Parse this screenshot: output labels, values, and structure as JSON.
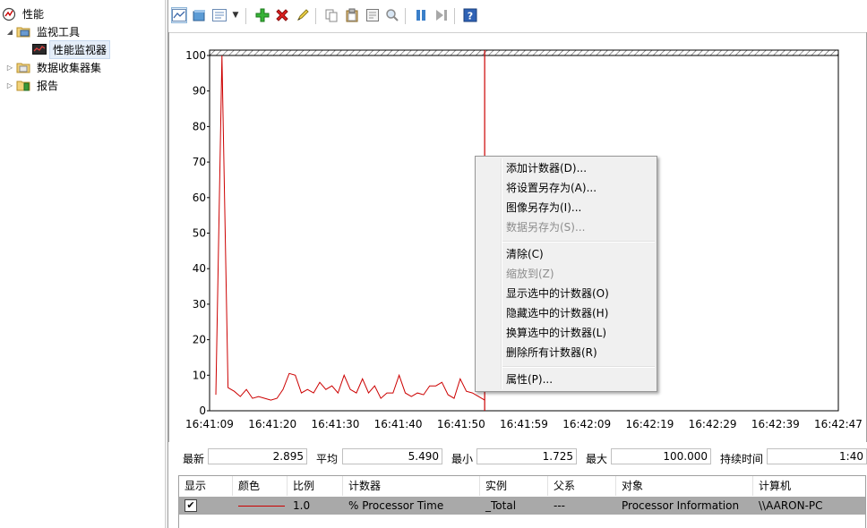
{
  "tree": {
    "root": "性能",
    "monitoring_tools": "监视工具",
    "performance_monitor": "性能监视器",
    "data_collector_sets": "数据收集器集",
    "reports": "报告"
  },
  "toolbar": {
    "icons": [
      "view-graph-icon",
      "view-histogram-icon",
      "view-report-icon",
      "dropdown-icon",
      "add-counter-icon",
      "delete-counter-icon",
      "highlight-icon",
      "copy-properties-icon",
      "paste-counters-icon",
      "properties-icon",
      "zoom-icon",
      "freeze-display-icon",
      "update-data-icon",
      "help-icon"
    ]
  },
  "chart_data": {
    "type": "line",
    "ylim": [
      0,
      100
    ],
    "yticks": [
      "100",
      "90",
      "80",
      "70",
      "60",
      "50",
      "40",
      "30",
      "20",
      "10",
      "0"
    ],
    "xticks": [
      "16:41:09",
      "16:41:20",
      "16:41:30",
      "16:41:40",
      "16:41:50",
      "16:41:59",
      "16:42:09",
      "16:42:19",
      "16:42:29",
      "16:42:39",
      "16:42:47"
    ],
    "series": [
      {
        "color": "#cc0000",
        "values": [
          4.5,
          100,
          6.5,
          5.5,
          4,
          6,
          3.5,
          4,
          3.5,
          3,
          3.5,
          6,
          10.5,
          10,
          5,
          6,
          5,
          8,
          6,
          7,
          5,
          10,
          6,
          5,
          9,
          5,
          7,
          3.5,
          5,
          5,
          10,
          5,
          4,
          5,
          4.5,
          7,
          7,
          8,
          4.5,
          3.5,
          9,
          5.5,
          5,
          4,
          3
        ]
      }
    ],
    "current_time_index": 44
  },
  "stats": {
    "last_label": "最新",
    "last_value": "2.895",
    "avg_label": "平均",
    "avg_value": "5.490",
    "min_label": "最小",
    "min_value": "1.725",
    "max_label": "最大",
    "max_value": "100.000",
    "duration_label": "持续时间",
    "duration_value": "1:40"
  },
  "grid": {
    "headers": {
      "show": "显示",
      "color": "颜色",
      "scale": "比例",
      "counter": "计数器",
      "instance": "实例",
      "parent": "父系",
      "object": "对象",
      "computer": "计算机"
    },
    "row": {
      "checked": true,
      "line_color": "#cc0000",
      "scale": "1.0",
      "counter": "% Processor Time",
      "instance": "_Total",
      "parent": "---",
      "object": "Processor Information",
      "computer": "\\\\AARON-PC"
    }
  },
  "context_menu": {
    "add_counters": "添加计数器(D)...",
    "save_settings_as": "将设置另存为(A)...",
    "save_image_as": "图像另存为(I)...",
    "save_data_as": "数据另存为(S)...",
    "clear": "清除(C)",
    "zoom_to": "缩放到(Z)",
    "show_selected": "显示选中的计数器(O)",
    "hide_selected": "隐藏选中的计数器(H)",
    "scale_selected": "换算选中的计数器(L)",
    "remove_all": "删除所有计数器(R)",
    "properties": "属性(P)..."
  }
}
